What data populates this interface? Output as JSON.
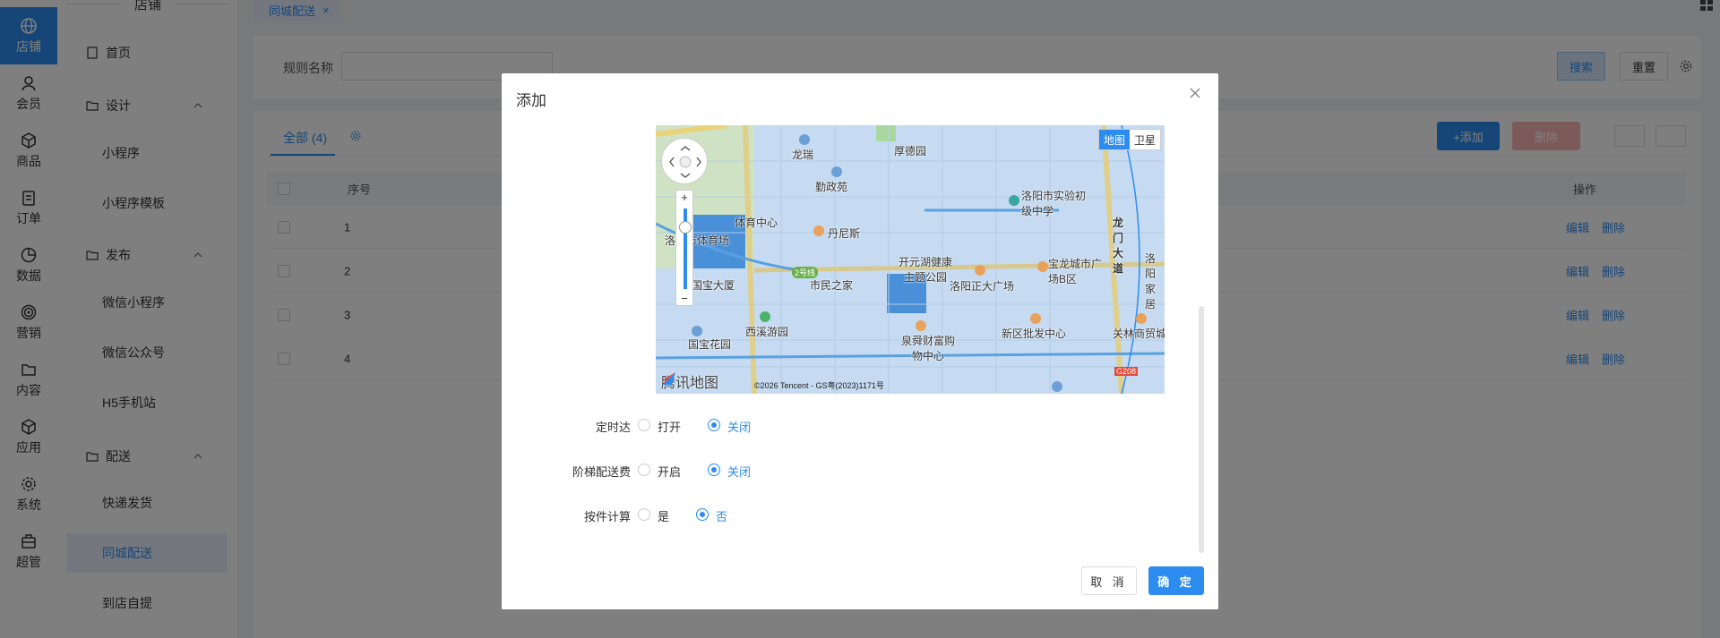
{
  "rail": [
    {
      "label": "店铺",
      "icon": "globe-icon",
      "active": true
    },
    {
      "label": "会员",
      "icon": "user-icon"
    },
    {
      "label": "商品",
      "icon": "box-icon"
    },
    {
      "label": "订单",
      "icon": "clipboard-icon"
    },
    {
      "label": "数据",
      "icon": "pie-chart-icon"
    },
    {
      "label": "营销",
      "icon": "target-icon"
    },
    {
      "label": "内容",
      "icon": "folder-icon"
    },
    {
      "label": "应用",
      "icon": "cube-icon"
    },
    {
      "label": "系统",
      "icon": "gear-icon"
    },
    {
      "label": "超管",
      "icon": "briefcase-icon"
    }
  ],
  "menu": {
    "header": "店铺",
    "home": "首页",
    "design": "设计",
    "design_items": [
      "小程序",
      "小程序模板"
    ],
    "publish": "发布",
    "publish_items": [
      "微信小程序",
      "微信公众号",
      "H5手机站"
    ],
    "delivery": "配送",
    "delivery_items": [
      "快递发货",
      "同城配送",
      "到店自提"
    ]
  },
  "tabs": {
    "active": "同城配送"
  },
  "search": {
    "label": "规则名称",
    "value": "",
    "search_btn": "搜索",
    "reset_btn": "重置"
  },
  "list": {
    "tab_label": "全部 (4)",
    "add_btn": "+添加",
    "delete_btn": "删除",
    "columns": {
      "seq": "序号",
      "op": "操作"
    },
    "rows": [
      {
        "seq": "1",
        "edit": "编辑",
        "del": "删除"
      },
      {
        "seq": "2",
        "edit": "编辑",
        "del": "删除"
      },
      {
        "seq": "3",
        "edit": "编辑",
        "del": "删除"
      },
      {
        "seq": "4",
        "edit": "编辑",
        "del": "删除"
      }
    ]
  },
  "modal": {
    "title": "添加",
    "map": {
      "toggle_map": "地图",
      "toggle_satellite": "卫星",
      "logo": "腾讯地图",
      "copyright": "©2026 Tencent - GS粤(2023)1171号",
      "labels": [
        "龙瑞",
        "厚德园",
        "勤政苑",
        "洛阳市实验初级中学",
        "体育中心",
        "丹尼斯",
        "洛阳市体育场",
        "开元湖健康主题公园",
        "宝龙城市广场B区",
        "龙门大道",
        "国宝大厦",
        "2号线",
        "市民之家",
        "洛阳正大广场",
        "西溪游园",
        "国宝花园",
        "泉舜财富购物中心",
        "新区批发中心",
        "关林商贸城",
        "G208",
        "洛阳家居"
      ]
    },
    "fields": [
      {
        "label": "定时达",
        "opt1": "打开",
        "opt2": "关闭",
        "selected": 2
      },
      {
        "label": "阶梯配送费",
        "opt1": "开启",
        "opt2": "关闭",
        "selected": 2
      },
      {
        "label": "按件计算",
        "opt1": "是",
        "opt2": "否",
        "selected": 2
      }
    ],
    "cancel": "取 消",
    "ok": "确 定"
  }
}
